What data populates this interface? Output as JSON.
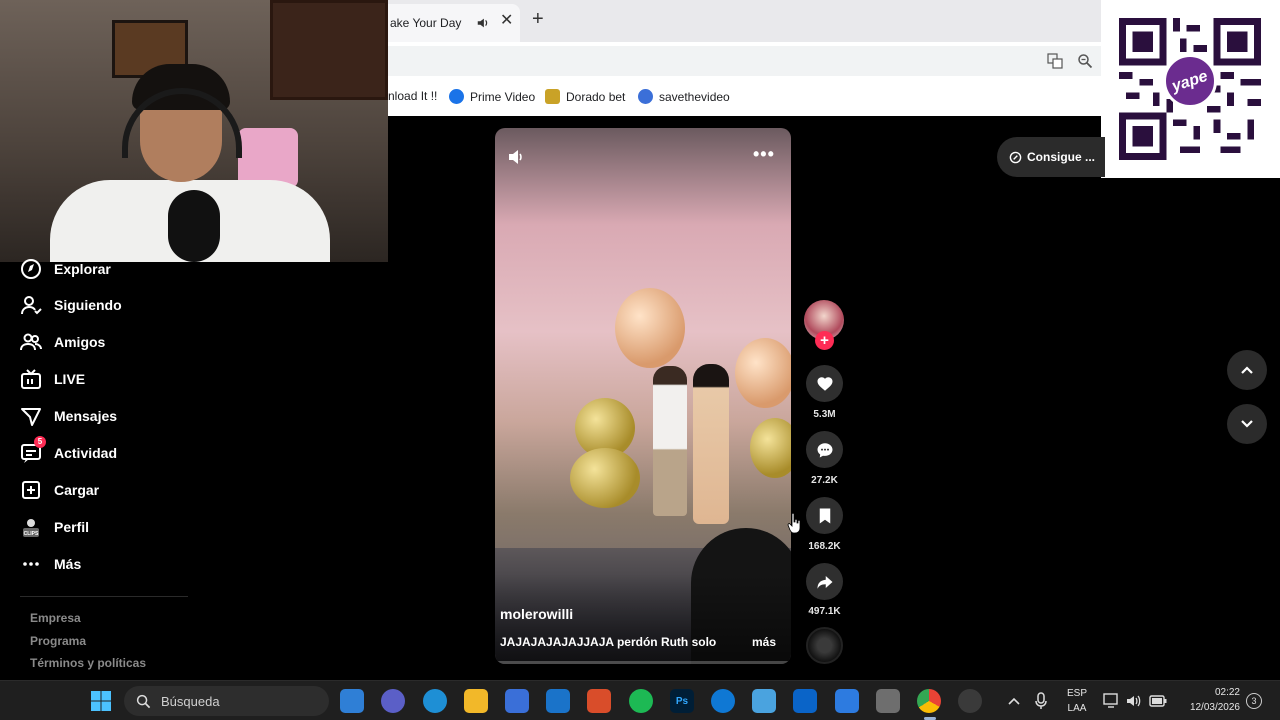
{
  "browser": {
    "tab_title": "ake Your Day",
    "bookmarks": [
      {
        "label": "nload It !!"
      },
      {
        "label": "Prime Video"
      },
      {
        "label": "Dorado bet"
      },
      {
        "label": "savethevideo"
      }
    ]
  },
  "qr": {
    "brand": "yape"
  },
  "sidebar": {
    "items": [
      {
        "label": "Explorar",
        "icon": "compass-icon"
      },
      {
        "label": "Siguiendo",
        "icon": "person-follow-icon"
      },
      {
        "label": "Amigos",
        "icon": "friends-icon"
      },
      {
        "label": "LIVE",
        "icon": "live-tv-icon"
      },
      {
        "label": "Mensajes",
        "icon": "send-icon"
      },
      {
        "label": "Actividad",
        "icon": "activity-icon",
        "badge": "5"
      },
      {
        "label": "Cargar",
        "icon": "upload-plus-icon"
      },
      {
        "label": "Perfil",
        "icon": "profile-icon",
        "icon_text": "CLIPS"
      },
      {
        "label": "Más",
        "icon": "more-dots-icon"
      }
    ],
    "footer_links": [
      "Empresa",
      "Programa",
      "Términos y políticas"
    ]
  },
  "video": {
    "username": "molerowilli",
    "caption": "JAJAJAJAJAJJAJA perdón Ruth solo",
    "more_label": "más",
    "progress": 0.0
  },
  "actions": {
    "likes": "5.3M",
    "comments": "27.2K",
    "saves": "168.2K",
    "shares": "497.1K"
  },
  "promo": {
    "label": "Consigue ..."
  },
  "taskbar": {
    "search_placeholder": "Búsqueda",
    "language_top": "ESP",
    "language_bottom": "LAA",
    "time": "02:22",
    "date": "12/03/2026",
    "notification_count": "3",
    "photoshop_label": "Ps"
  },
  "colors": {
    "accent": "#fe2c55",
    "background": "#000000",
    "chrome_bg": "#ffffff",
    "taskbar_bg": "#1f1f1f"
  }
}
